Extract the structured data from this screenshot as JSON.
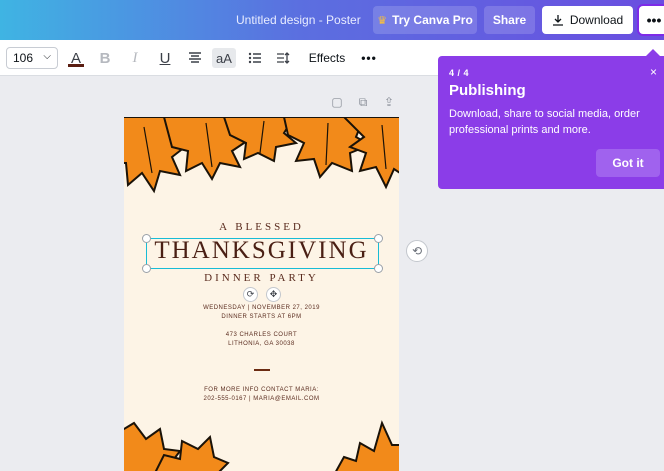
{
  "header": {
    "design_title": "Untitled design - Poster",
    "try_pro_label": "Try Canva Pro",
    "share_label": "Share",
    "download_label": "Download",
    "more_label": "•••"
  },
  "toolbar": {
    "font_size": "106",
    "text_color": "#5a1e12",
    "bold_label": "B",
    "italic_label": "I",
    "underline_label": "U",
    "case_label": "aA",
    "effects_label": "Effects",
    "more_label": "•••"
  },
  "poster": {
    "line1": "A BLESSED",
    "headline": "THANKSGIVING",
    "line2": "DINNER PARTY",
    "date": "WEDNESDAY | NOVEMBER 27, 2019",
    "time": "DINNER STARTS AT 6PM",
    "address1": "473 CHARLES COURT",
    "address2": "LITHONIA, GA 30038",
    "contact1": "FOR MORE INFO CONTACT MARIA:",
    "contact2": "202-555-0167 | MARIA@EMAIL.COM",
    "leaf_color": "#f28a1a"
  },
  "tooltip": {
    "step": "4 / 4",
    "title": "Publishing",
    "body": "Download, share to social media, order professional prints and more.",
    "button_label": "Got it",
    "close_label": "×"
  }
}
